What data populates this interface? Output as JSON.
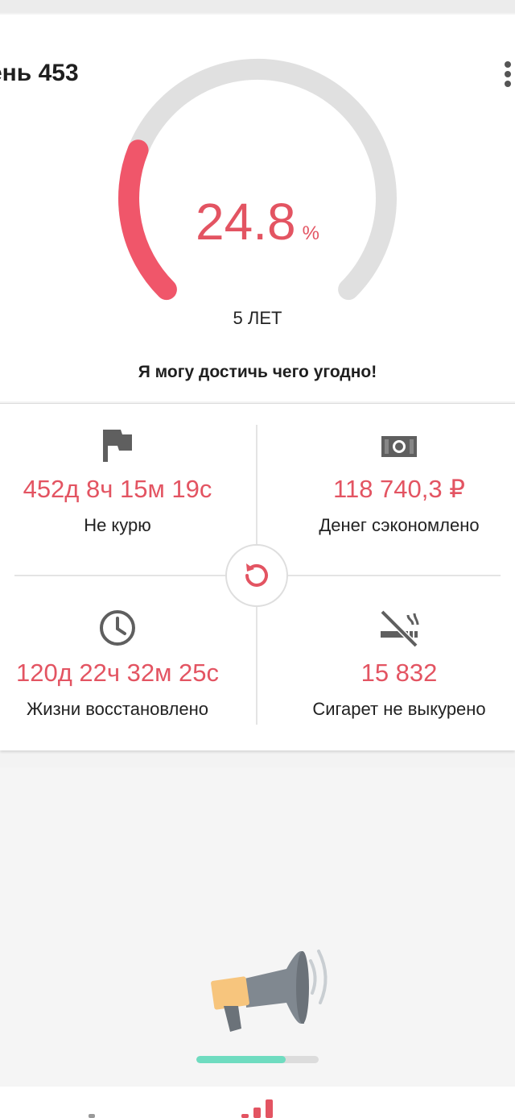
{
  "header": {
    "level_title": "ень 453",
    "menu_icon": "more-vert-icon"
  },
  "gauge": {
    "progress": 0.248,
    "value": "24.8",
    "unit": "%",
    "goal_label": "5 ЛЕТ",
    "track_color": "#e0e0e0",
    "fill_color": "#f0566a"
  },
  "motivation": "Я могу достичь чего угодно!",
  "stats": {
    "not_smoking": {
      "icon": "flag-icon",
      "value": "452д 8ч 15м 19с",
      "label": "Не курю"
    },
    "money_saved": {
      "icon": "money-icon",
      "value": "118 740,3 ₽",
      "label": "Денег сэкономлено"
    },
    "life_regained": {
      "icon": "clock-icon",
      "value": "120д 22ч 32м 25с",
      "label": "Жизни восстановлено"
    },
    "cigarettes_not_smoked": {
      "icon": "no-smoking-icon",
      "value": "15 832",
      "label": "Сигарет не выкурено"
    }
  },
  "reset_icon": "reset-icon",
  "promo": {
    "icon": "megaphone-icon",
    "progress": 0.73
  },
  "colors": {
    "accent": "#e35462",
    "icon_gray": "#5f5f5f",
    "progress_green": "#6fdcc0"
  },
  "bottom_nav": {
    "icon": "stats-bars-icon"
  }
}
